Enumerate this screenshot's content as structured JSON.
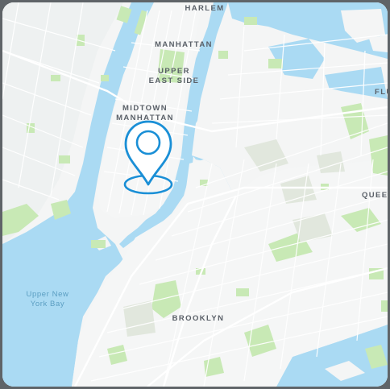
{
  "map": {
    "labels": {
      "harlem": "HARLEM",
      "manhattan": "MANHATTAN",
      "upper_east_side_1": "UPPER",
      "upper_east_side_2": "EAST SIDE",
      "midtown_1": "MIDTOWN",
      "midtown_2": "MANHATTAN",
      "flushing_partial": "FLU",
      "queens_partial": "QUEE",
      "brooklyn": "BROOKLYN",
      "upper_new_york_bay_1": "Upper New",
      "upper_new_york_bay_2": "York Bay"
    },
    "colors": {
      "water": "#aadaf3",
      "land": "#f5f6f6",
      "park": "#c8e9b5",
      "industrial": "#e0e6dc",
      "road": "#ffffff",
      "pin": "#1a8fd6"
    },
    "marker_icon": "location-pin-icon"
  }
}
